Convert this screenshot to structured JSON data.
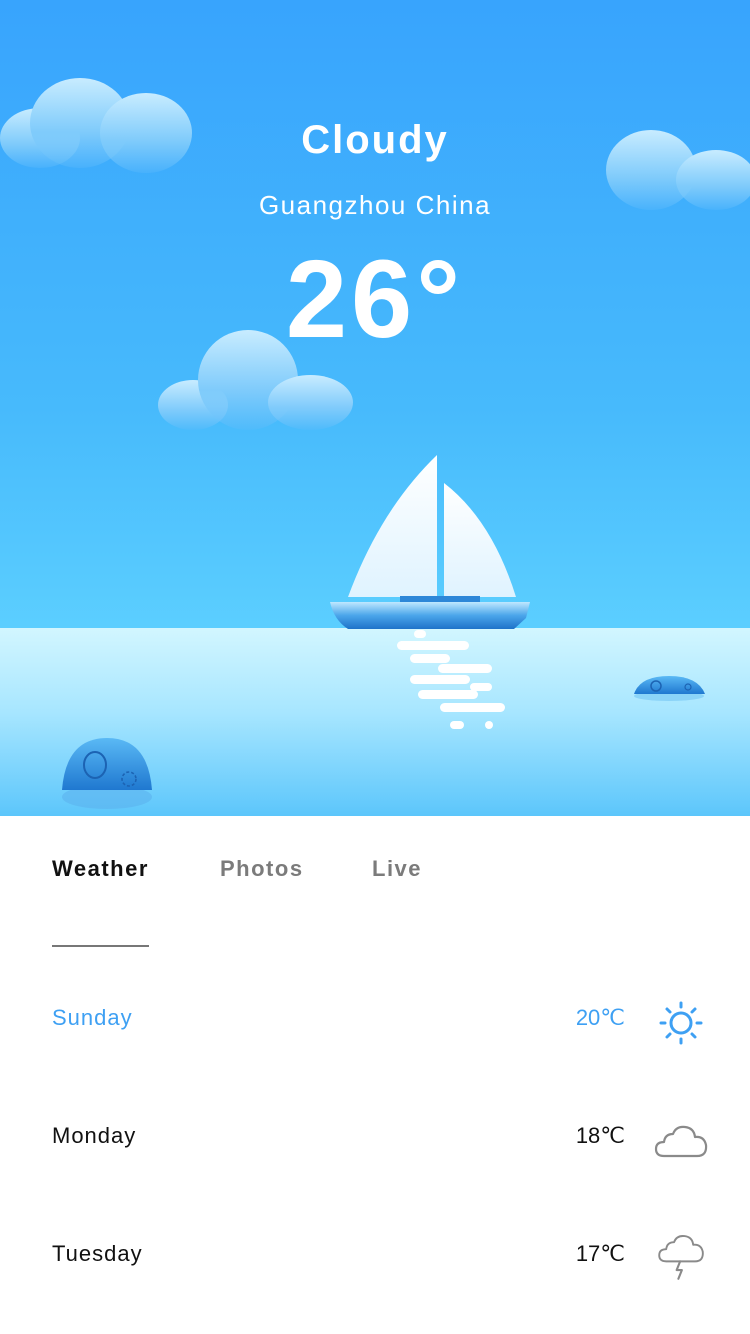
{
  "hero": {
    "condition": "Cloudy",
    "location": "Guangzhou China",
    "temperature": "26°"
  },
  "tabs": [
    {
      "label": "Weather",
      "active": true
    },
    {
      "label": "Photos",
      "active": false
    },
    {
      "label": "Live",
      "active": false
    }
  ],
  "forecast": [
    {
      "day": "Sunday",
      "temp": "20℃",
      "icon": "sun-icon",
      "highlighted": true
    },
    {
      "day": "Monday",
      "temp": "18℃",
      "icon": "cloud-icon",
      "highlighted": false
    },
    {
      "day": "Tuesday",
      "temp": "17℃",
      "icon": "thunderstorm-icon",
      "highlighted": false
    }
  ],
  "colors": {
    "sky_top": "#38a4fd",
    "sky_bottom": "#5ccfff",
    "accent": "#3ea0f3",
    "icon_gray": "#8a8a8a"
  }
}
